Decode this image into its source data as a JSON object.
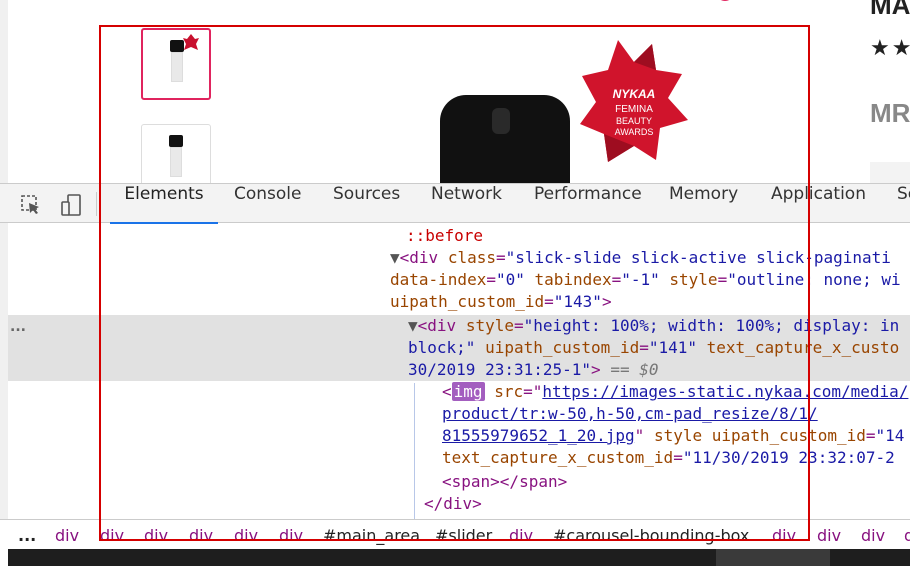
{
  "product": {
    "title_fragment": "MA",
    "stars": "★★",
    "mrp_fragment": "MR",
    "award_text": "NYKAA FEMINA BEAUTY AWARDS"
  },
  "devtools": {
    "tabs": [
      "Elements",
      "Console",
      "Sources",
      "Network",
      "Performance",
      "Memory",
      "Application",
      "Se"
    ],
    "active_tab": "Elements",
    "dom": {
      "l1": "::before",
      "l2_tag_open": "<div",
      "l2_attr1": "class",
      "l2_val1": "\"slick-slide slick-active slick-paginati",
      "l3_attr1": "data-index",
      "l3_val1": "\"0\"",
      "l3_attr2": "tabindex",
      "l3_val2": "\"-1\"",
      "l3_attr3": "style",
      "l3_val3": "\"outline: none; wi",
      "l4_attr1": "uipath_custom_id",
      "l4_val1": "\"143\"",
      "l4_close": ">",
      "l5_tag_open": "<div",
      "l5_attr1": "style",
      "l5_val1": "\"height: 100%; width: 100%; display: in",
      "l6_val1": "block;\"",
      "l6_attr2": "uipath_custom_id",
      "l6_val2": "\"141\"",
      "l6_attr3": "text_capture_x_custo",
      "l7_val1": "30/2019 23:31:25-1\"",
      "l7_close": ">",
      "l7_eq": "== $0",
      "l8_lt": "<",
      "l8_tag": "img",
      "l8_attr1": "src",
      "l8_link": "https://images-static.nykaa.com/media/",
      "l9_link": "product/tr:w-50,h-50,cm-pad_resize/8/1/",
      "l10_link": "81555979652_1_20.jpg",
      "l10_attr2": "style",
      "l10_attr3": "uipath_custom_id",
      "l10_val3": "\"14",
      "l11_attr1": "text_capture_x_custom_id",
      "l11_val1": "\"11/30/2019 23:32:07-2",
      "l12": "<span></span>",
      "l13": "</div>"
    },
    "breadcrumbs": [
      "...",
      "div",
      "div",
      "div",
      "div",
      "div",
      "div",
      "#main_area",
      "#slider",
      "div",
      "#carousel-bounding-box",
      "div",
      "div",
      "div",
      "d"
    ],
    "gutter_dots": "..."
  }
}
